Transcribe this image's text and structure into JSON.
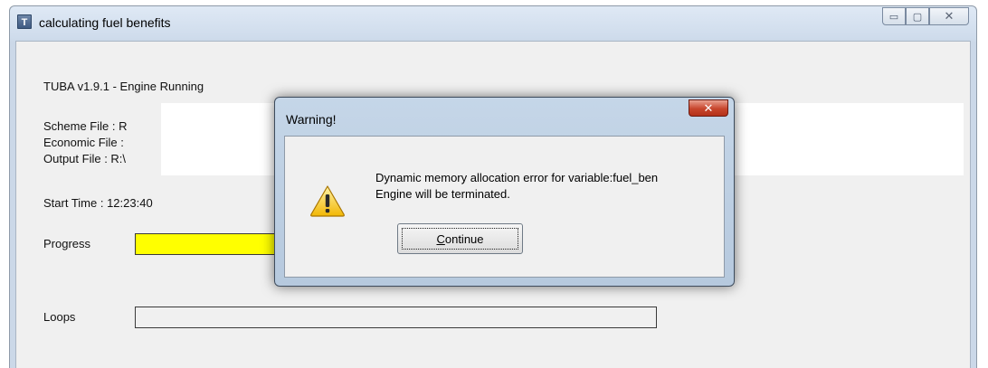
{
  "window": {
    "title": "calculating fuel benefits",
    "app_icon_letter": "T",
    "controls": {
      "minimize": "▭",
      "restore": "▢",
      "close": "✕"
    }
  },
  "main": {
    "header": "TUBA v1.9.1 - Engine Running",
    "scheme_file_label": "Scheme File : R",
    "economic_file_label": "Economic File :",
    "output_file_label": "Output File : R:\\",
    "start_time_label": "Start Time : 12:23:40",
    "progress_label": "Progress",
    "loops_label": "Loops",
    "progress_fill_fraction": 0.27,
    "progress_color": "#ffff00"
  },
  "dialog": {
    "title": "Warning!",
    "close_glyph": "✕",
    "icon": "warning-icon",
    "message_line1": "Dynamic memory allocation error for variable:fuel_ben",
    "message_line2": "Engine will be terminated.",
    "continue_accel": "C",
    "continue_rest": "ontinue"
  }
}
